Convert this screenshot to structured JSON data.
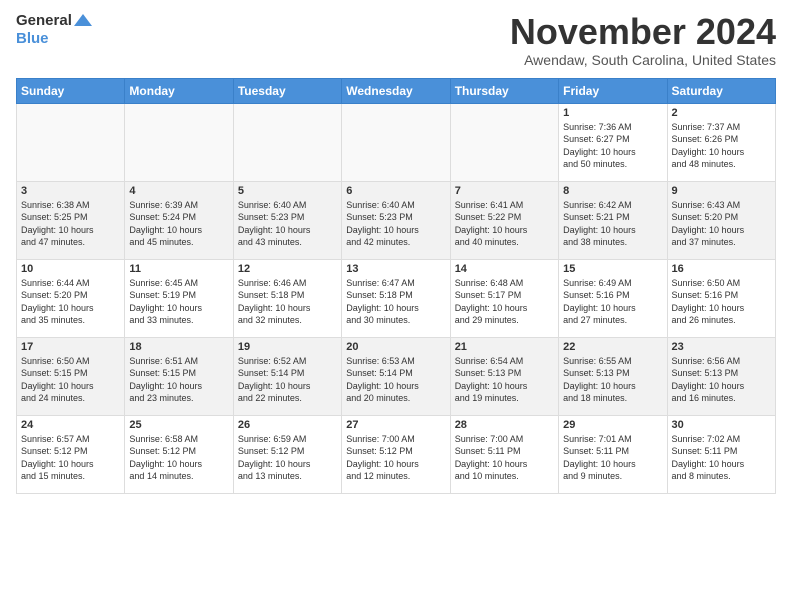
{
  "logo": {
    "line1": "General",
    "line2": "Blue"
  },
  "title": "November 2024",
  "subtitle": "Awendaw, South Carolina, United States",
  "weekdays": [
    "Sunday",
    "Monday",
    "Tuesday",
    "Wednesday",
    "Thursday",
    "Friday",
    "Saturday"
  ],
  "weeks": [
    [
      {
        "day": "",
        "info": ""
      },
      {
        "day": "",
        "info": ""
      },
      {
        "day": "",
        "info": ""
      },
      {
        "day": "",
        "info": ""
      },
      {
        "day": "",
        "info": ""
      },
      {
        "day": "1",
        "info": "Sunrise: 7:36 AM\nSunset: 6:27 PM\nDaylight: 10 hours\nand 50 minutes."
      },
      {
        "day": "2",
        "info": "Sunrise: 7:37 AM\nSunset: 6:26 PM\nDaylight: 10 hours\nand 48 minutes."
      }
    ],
    [
      {
        "day": "3",
        "info": "Sunrise: 6:38 AM\nSunset: 5:25 PM\nDaylight: 10 hours\nand 47 minutes."
      },
      {
        "day": "4",
        "info": "Sunrise: 6:39 AM\nSunset: 5:24 PM\nDaylight: 10 hours\nand 45 minutes."
      },
      {
        "day": "5",
        "info": "Sunrise: 6:40 AM\nSunset: 5:23 PM\nDaylight: 10 hours\nand 43 minutes."
      },
      {
        "day": "6",
        "info": "Sunrise: 6:40 AM\nSunset: 5:23 PM\nDaylight: 10 hours\nand 42 minutes."
      },
      {
        "day": "7",
        "info": "Sunrise: 6:41 AM\nSunset: 5:22 PM\nDaylight: 10 hours\nand 40 minutes."
      },
      {
        "day": "8",
        "info": "Sunrise: 6:42 AM\nSunset: 5:21 PM\nDaylight: 10 hours\nand 38 minutes."
      },
      {
        "day": "9",
        "info": "Sunrise: 6:43 AM\nSunset: 5:20 PM\nDaylight: 10 hours\nand 37 minutes."
      }
    ],
    [
      {
        "day": "10",
        "info": "Sunrise: 6:44 AM\nSunset: 5:20 PM\nDaylight: 10 hours\nand 35 minutes."
      },
      {
        "day": "11",
        "info": "Sunrise: 6:45 AM\nSunset: 5:19 PM\nDaylight: 10 hours\nand 33 minutes."
      },
      {
        "day": "12",
        "info": "Sunrise: 6:46 AM\nSunset: 5:18 PM\nDaylight: 10 hours\nand 32 minutes."
      },
      {
        "day": "13",
        "info": "Sunrise: 6:47 AM\nSunset: 5:18 PM\nDaylight: 10 hours\nand 30 minutes."
      },
      {
        "day": "14",
        "info": "Sunrise: 6:48 AM\nSunset: 5:17 PM\nDaylight: 10 hours\nand 29 minutes."
      },
      {
        "day": "15",
        "info": "Sunrise: 6:49 AM\nSunset: 5:16 PM\nDaylight: 10 hours\nand 27 minutes."
      },
      {
        "day": "16",
        "info": "Sunrise: 6:50 AM\nSunset: 5:16 PM\nDaylight: 10 hours\nand 26 minutes."
      }
    ],
    [
      {
        "day": "17",
        "info": "Sunrise: 6:50 AM\nSunset: 5:15 PM\nDaylight: 10 hours\nand 24 minutes."
      },
      {
        "day": "18",
        "info": "Sunrise: 6:51 AM\nSunset: 5:15 PM\nDaylight: 10 hours\nand 23 minutes."
      },
      {
        "day": "19",
        "info": "Sunrise: 6:52 AM\nSunset: 5:14 PM\nDaylight: 10 hours\nand 22 minutes."
      },
      {
        "day": "20",
        "info": "Sunrise: 6:53 AM\nSunset: 5:14 PM\nDaylight: 10 hours\nand 20 minutes."
      },
      {
        "day": "21",
        "info": "Sunrise: 6:54 AM\nSunset: 5:13 PM\nDaylight: 10 hours\nand 19 minutes."
      },
      {
        "day": "22",
        "info": "Sunrise: 6:55 AM\nSunset: 5:13 PM\nDaylight: 10 hours\nand 18 minutes."
      },
      {
        "day": "23",
        "info": "Sunrise: 6:56 AM\nSunset: 5:13 PM\nDaylight: 10 hours\nand 16 minutes."
      }
    ],
    [
      {
        "day": "24",
        "info": "Sunrise: 6:57 AM\nSunset: 5:12 PM\nDaylight: 10 hours\nand 15 minutes."
      },
      {
        "day": "25",
        "info": "Sunrise: 6:58 AM\nSunset: 5:12 PM\nDaylight: 10 hours\nand 14 minutes."
      },
      {
        "day": "26",
        "info": "Sunrise: 6:59 AM\nSunset: 5:12 PM\nDaylight: 10 hours\nand 13 minutes."
      },
      {
        "day": "27",
        "info": "Sunrise: 7:00 AM\nSunset: 5:12 PM\nDaylight: 10 hours\nand 12 minutes."
      },
      {
        "day": "28",
        "info": "Sunrise: 7:00 AM\nSunset: 5:11 PM\nDaylight: 10 hours\nand 10 minutes."
      },
      {
        "day": "29",
        "info": "Sunrise: 7:01 AM\nSunset: 5:11 PM\nDaylight: 10 hours\nand 9 minutes."
      },
      {
        "day": "30",
        "info": "Sunrise: 7:02 AM\nSunset: 5:11 PM\nDaylight: 10 hours\nand 8 minutes."
      }
    ]
  ]
}
